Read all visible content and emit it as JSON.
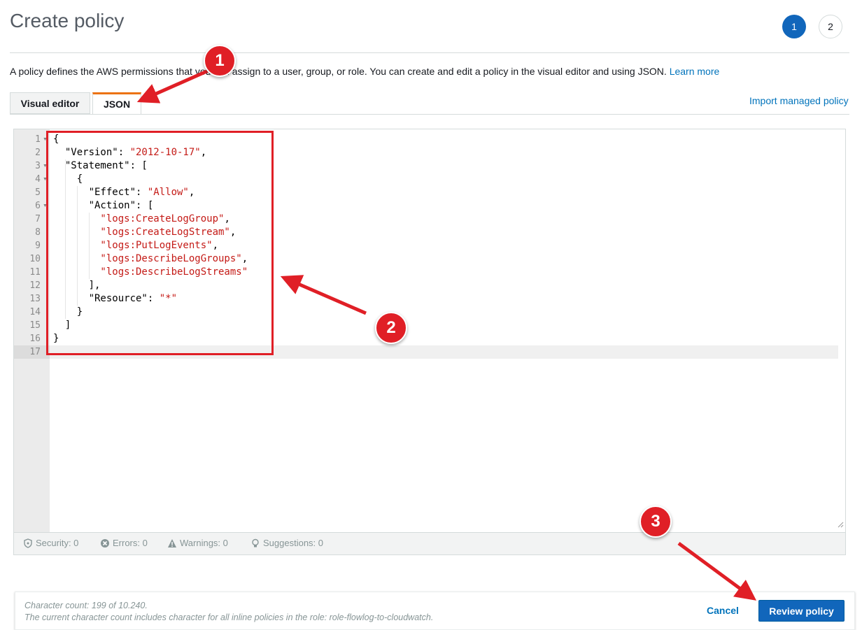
{
  "header": {
    "title": "Create policy",
    "steps": [
      "1",
      "2"
    ]
  },
  "description": {
    "text": "A policy defines the AWS permissions that you can assign to a user, group, or role. You can create and edit a policy in the visual editor and using JSON.",
    "link": "Learn more"
  },
  "tabs": {
    "visual": "Visual editor",
    "json": "JSON",
    "import_link": "Import managed policy"
  },
  "editor": {
    "line_numbers": [
      "1",
      "2",
      "3",
      "4",
      "5",
      "6",
      "7",
      "8",
      "9",
      "10",
      "11",
      "12",
      "13",
      "14",
      "15",
      "16",
      "17"
    ],
    "code": {
      "l1": "{",
      "l2_key": "  \"Version\": ",
      "l2_val": "\"2012-10-17\"",
      "l2_end": ",",
      "l3": "  \"Statement\": [",
      "l4": "    {",
      "l5_key": "      \"Effect\": ",
      "l5_val": "\"Allow\"",
      "l5_end": ",",
      "l6": "      \"Action\": [",
      "l7_val": "        \"logs:CreateLogGroup\"",
      "l7_end": ",",
      "l8_val": "        \"logs:CreateLogStream\"",
      "l8_end": ",",
      "l9_val": "        \"logs:PutLogEvents\"",
      "l9_end": ",",
      "l10_val": "        \"logs:DescribeLogGroups\"",
      "l10_end": ",",
      "l11_val": "        \"logs:DescribeLogStreams\"",
      "l12": "      ],",
      "l13_key": "      \"Resource\": ",
      "l13_val": "\"*\"",
      "l14": "    }",
      "l15": "  ]",
      "l16": "}"
    },
    "status": {
      "security": "Security: 0",
      "errors": "Errors: 0",
      "warnings": "Warnings: 0",
      "suggestions": "Suggestions: 0"
    }
  },
  "footer": {
    "char_count": "Character count: 199 of 10.240.",
    "char_note": "The current character count includes character for all inline policies in the role: role-flowlog-to-cloudwatch.",
    "cancel": "Cancel",
    "review": "Review policy"
  },
  "annotations": {
    "badges": [
      "1",
      "2",
      "3"
    ],
    "color": "#e01f26"
  },
  "colors": {
    "primary": "#1166bb",
    "link": "#0073bb",
    "tab_accent": "#ec7211",
    "string": "#c41a16"
  }
}
